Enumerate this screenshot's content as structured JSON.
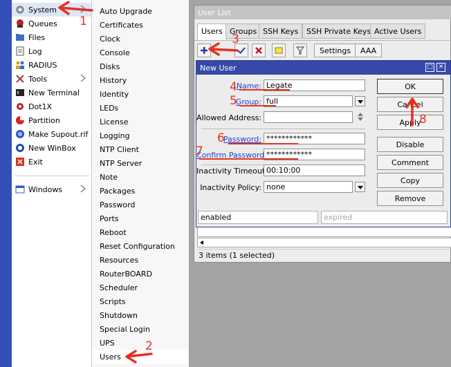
{
  "main_menu": {
    "items": [
      {
        "label": "System",
        "icon": "gear-icon",
        "submenu": true,
        "selected": true
      },
      {
        "label": "Queues",
        "icon": "queues-icon"
      },
      {
        "label": "Files",
        "icon": "folder-icon"
      },
      {
        "label": "Log",
        "icon": "log-icon"
      },
      {
        "label": "RADIUS",
        "icon": "users-icon"
      },
      {
        "label": "Tools",
        "icon": "tools-icon",
        "submenu": true
      },
      {
        "label": "New Terminal",
        "icon": "terminal-icon"
      },
      {
        "label": "Dot1X",
        "icon": "dot1x-icon"
      },
      {
        "label": "Partition",
        "icon": "partition-icon"
      },
      {
        "label": "Make Supout.rif",
        "icon": "supout-icon"
      },
      {
        "label": "New WinBox",
        "icon": "winbox-icon"
      },
      {
        "label": "Exit",
        "icon": "exit-icon"
      }
    ],
    "windows": {
      "label": "Windows",
      "icon": "window-icon",
      "submenu": true
    }
  },
  "system_submenu": {
    "items": [
      "Auto Upgrade",
      "Certificates",
      "Clock",
      "Console",
      "Disks",
      "History",
      "Identity",
      "LEDs",
      "License",
      "Logging",
      "NTP Client",
      "NTP Server",
      "Note",
      "Packages",
      "Password",
      "Ports",
      "Reboot",
      "Reset Configuration",
      "Resources",
      "RouterBOARD",
      "Scheduler",
      "Scripts",
      "Shutdown",
      "Special Login",
      "UPS",
      "Users"
    ]
  },
  "user_list": {
    "title": "User List",
    "tabs": [
      "Users",
      "Groups",
      "SSH Keys",
      "SSH Private Keys",
      "Active Users"
    ],
    "active_tab": "Users",
    "toolbar": {
      "settings_label": "Settings",
      "aaa_label": "AAA"
    },
    "status": "3 items (1 selected)"
  },
  "new_user": {
    "title": "New User",
    "fields": {
      "name": {
        "label": "Name:",
        "value": "Legate"
      },
      "group": {
        "label": "Group:",
        "value": "full"
      },
      "allowed_address": {
        "label": "Allowed Address:",
        "value": ""
      },
      "password": {
        "label": "Password:",
        "value": "************"
      },
      "confirm_password": {
        "label": "Confirm Password:",
        "value": "************"
      },
      "inactivity_timeout": {
        "label": "Inactivity Timeout:",
        "value": "00:10:00"
      },
      "inactivity_policy": {
        "label": "Inactivity Policy:",
        "value": "none"
      }
    },
    "buttons": {
      "ok": "OK",
      "cancel": "Cancel",
      "apply": "Apply",
      "disable": "Disable",
      "comment": "Comment",
      "copy": "Copy",
      "remove": "Remove"
    },
    "status_left": "enabled",
    "status_right": "expired"
  },
  "annotations": [
    "1",
    "2",
    "3",
    "4",
    "5",
    "6",
    "7",
    "8"
  ],
  "colors": {
    "annotation": "#e53121",
    "dialog_title": "#3649a8",
    "link": "#1f3fd0",
    "sidebar": "#3450b8"
  }
}
